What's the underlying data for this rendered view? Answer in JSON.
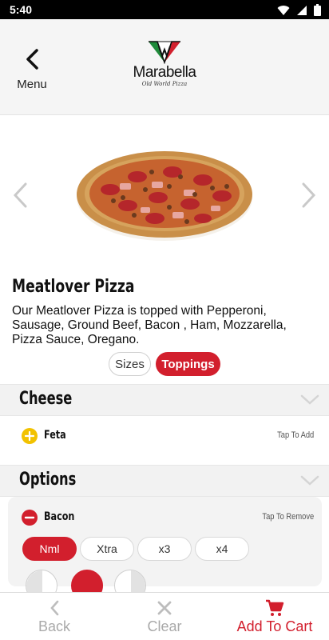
{
  "status_bar": {
    "time": "5:40"
  },
  "header": {
    "back_label": "Menu",
    "brand": "Marabella",
    "tagline": "Old World Pizza"
  },
  "product": {
    "name": "Meatlover Pizza",
    "description": "Our Meatlover Pizza is topped with Pepperoni, Sausage, Ground Beef, Bacon , Ham, Mozzarella, Pizza Sauce, Oregano."
  },
  "segments": {
    "sizes": "Sizes",
    "toppings": "Toppings",
    "selected": "Toppings"
  },
  "sections": {
    "cheese": {
      "title": "Cheese",
      "items": [
        {
          "name": "Feta",
          "action": "Tap To Add"
        }
      ]
    },
    "options": {
      "title": "Options",
      "items": [
        {
          "name": "Bacon",
          "action": "Tap To Remove"
        }
      ],
      "quantity_options": [
        "Nml",
        "Xtra",
        "x3",
        "x4"
      ],
      "selected_quantity": "Nml"
    }
  },
  "bottom_bar": {
    "back": "Back",
    "clear": "Clear",
    "add_to_cart": "Add To Cart"
  },
  "colors": {
    "accent": "#d21f2d",
    "add": "#f2c200",
    "muted": "#a9a9a9"
  },
  "icons": {
    "wifi": "wifi-icon",
    "signal": "signal-icon",
    "battery": "battery-icon",
    "menu_back": "chevron-left-icon",
    "prev": "chevron-left-icon",
    "next": "chevron-right-icon",
    "add": "plus-circle-icon",
    "remove": "minus-circle-icon",
    "collapse": "chevron-down-icon",
    "clear": "close-icon",
    "cart": "cart-icon"
  }
}
